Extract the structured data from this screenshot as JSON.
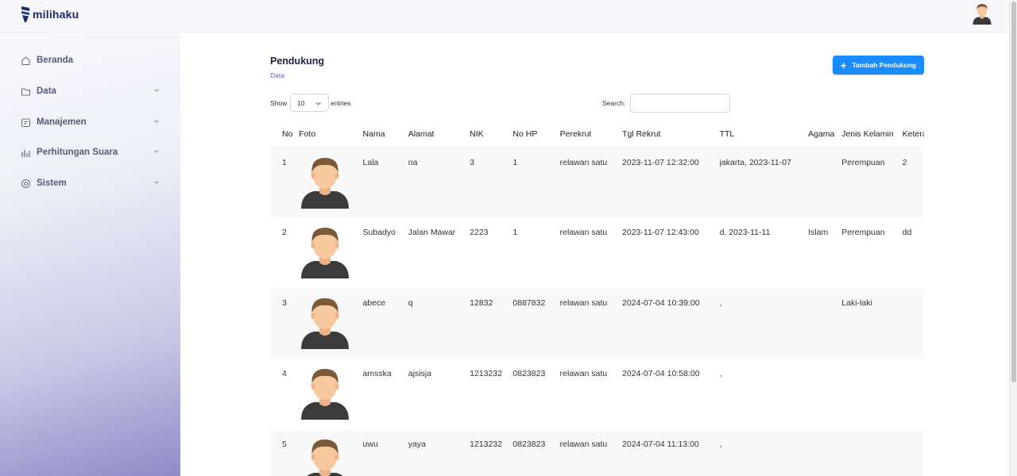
{
  "app": {
    "brand": "milihaku"
  },
  "sidebar": {
    "items": [
      {
        "label": "Beranda",
        "icon": "home-icon",
        "has_chevron": false
      },
      {
        "label": "Data",
        "icon": "folder-icon",
        "has_chevron": true
      },
      {
        "label": "Manajemen",
        "icon": "manage-icon",
        "has_chevron": true
      },
      {
        "label": "Perhitungan Suara",
        "icon": "bar-chart-icon",
        "has_chevron": true
      },
      {
        "label": "Sistem",
        "icon": "settings-icon",
        "has_chevron": true
      }
    ]
  },
  "page": {
    "title": "Pendukung",
    "breadcrumb": "Data",
    "add_button_label": "Tambah Pendukung"
  },
  "table_controls": {
    "show_label": "Show",
    "entries_value": "10",
    "entries_label": "entries",
    "search_label": "Search:",
    "search_value": ""
  },
  "table": {
    "columns": [
      "No",
      "Foto",
      "Nama",
      "Alamat",
      "NIK",
      "No HP",
      "Perekrut",
      "Tgl Rekrut",
      "TTL",
      "Agama",
      "Jenis Kelamin",
      "Keterangan"
    ],
    "rows": [
      {
        "no": "1",
        "nama": "Lala",
        "alamat": "na",
        "nik": "3",
        "hp": "1",
        "perekrut": "relawan satu",
        "tgl": "2023-11-07 12:32:00",
        "ttl": "jakarta, 2023-11-07",
        "agama": "",
        "jk": "Perempuan",
        "ket": "2"
      },
      {
        "no": "2",
        "nama": "Subadyo",
        "alamat": "Jalan Mawar",
        "nik": "2223",
        "hp": "1",
        "perekrut": "relawan satu",
        "tgl": "2023-11-07 12:43:00",
        "ttl": "d, 2023-11-11",
        "agama": "Islam",
        "jk": "Perempuan",
        "ket": "dd"
      },
      {
        "no": "3",
        "nama": "abece",
        "alamat": "q",
        "nik": "12832",
        "hp": "0887832",
        "perekrut": "relawan satu",
        "tgl": "2024-07-04 10:39:00",
        "ttl": ",",
        "agama": "",
        "jk": "Laki-laki",
        "ket": ""
      },
      {
        "no": "4",
        "nama": "amsska",
        "alamat": "ajsisja",
        "nik": "1213232",
        "hp": "0823823",
        "perekrut": "relawan satu",
        "tgl": "2024-07-04 10:58:00",
        "ttl": ",",
        "agama": "",
        "jk": "",
        "ket": ""
      },
      {
        "no": "5",
        "nama": "uwu",
        "alamat": "yaya",
        "nik": "1213232",
        "hp": "0823823",
        "perekrut": "relawan satu",
        "tgl": "2024-07-04 11:13:00",
        "ttl": ",",
        "agama": "",
        "jk": "",
        "ket": ""
      }
    ]
  },
  "colors": {
    "brand": "#1d2a6b",
    "accent": "#1a8cff",
    "breadcrumb": "#5a5bd6",
    "sidebar_text": "#555b77"
  }
}
